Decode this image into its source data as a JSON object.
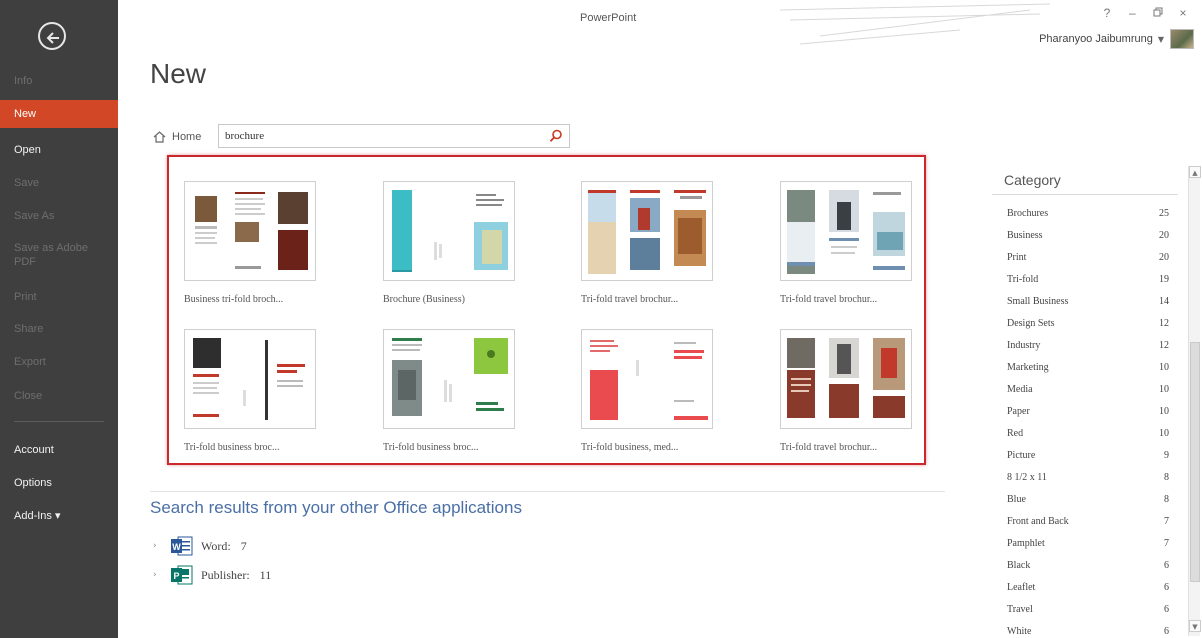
{
  "window": {
    "app_title": "PowerPoint",
    "controls": {
      "help": "?",
      "minimize": "–",
      "restore": "̣",
      "close": "×"
    },
    "user": "Pharanyoo Jaibumrung"
  },
  "sidebar": {
    "items": [
      {
        "label": "Info",
        "state": "disabled"
      },
      {
        "label": "New",
        "state": "active"
      },
      {
        "label": "Open",
        "state": "enabled"
      },
      {
        "label": "Save",
        "state": "disabled"
      },
      {
        "label": "Save As",
        "state": "disabled"
      },
      {
        "label": "Save as Adobe PDF",
        "state": "disabled"
      },
      {
        "label": "Print",
        "state": "disabled"
      },
      {
        "label": "Share",
        "state": "disabled"
      },
      {
        "label": "Export",
        "state": "disabled"
      },
      {
        "label": "Close",
        "state": "disabled"
      },
      {
        "label": "Account",
        "state": "enabled"
      },
      {
        "label": "Options",
        "state": "enabled"
      },
      {
        "label": "Add-Ins ▾",
        "state": "enabled"
      }
    ],
    "accent_color": "#d24726"
  },
  "page": {
    "title": "New"
  },
  "search": {
    "home_label": "Home",
    "query": "brochure"
  },
  "templates": [
    {
      "label": "Business tri-fold broch..."
    },
    {
      "label": "Brochure (Business)"
    },
    {
      "label": "Tri-fold travel brochur..."
    },
    {
      "label": "Tri-fold travel brochur..."
    },
    {
      "label": "Tri-fold business broc..."
    },
    {
      "label": "Tri-fold business broc..."
    },
    {
      "label": "Tri-fold business, med..."
    },
    {
      "label": "Tri-fold travel brochur..."
    }
  ],
  "other_results": {
    "heading": "Search results from your other Office applications",
    "apps": [
      {
        "name": "Word:",
        "count": "7",
        "icon": "word-icon"
      },
      {
        "name": "Publisher:",
        "count": "11",
        "icon": "publisher-icon"
      }
    ]
  },
  "category": {
    "title": "Category",
    "items": [
      {
        "name": "Brochures",
        "count": "25"
      },
      {
        "name": "Business",
        "count": "20"
      },
      {
        "name": "Print",
        "count": "20"
      },
      {
        "name": "Tri-fold",
        "count": "19"
      },
      {
        "name": "Small Business",
        "count": "14"
      },
      {
        "name": "Design Sets",
        "count": "12"
      },
      {
        "name": "Industry",
        "count": "12"
      },
      {
        "name": "Marketing",
        "count": "10"
      },
      {
        "name": "Media",
        "count": "10"
      },
      {
        "name": "Paper",
        "count": "10"
      },
      {
        "name": "Red",
        "count": "10"
      },
      {
        "name": "Picture",
        "count": "9"
      },
      {
        "name": "8 1/2 x 11",
        "count": "8"
      },
      {
        "name": "Blue",
        "count": "8"
      },
      {
        "name": "Front and Back",
        "count": "7"
      },
      {
        "name": "Pamphlet",
        "count": "7"
      },
      {
        "name": "Black",
        "count": "6"
      },
      {
        "name": "Leaflet",
        "count": "6"
      },
      {
        "name": "Travel",
        "count": "6"
      },
      {
        "name": "White",
        "count": "6"
      }
    ]
  }
}
